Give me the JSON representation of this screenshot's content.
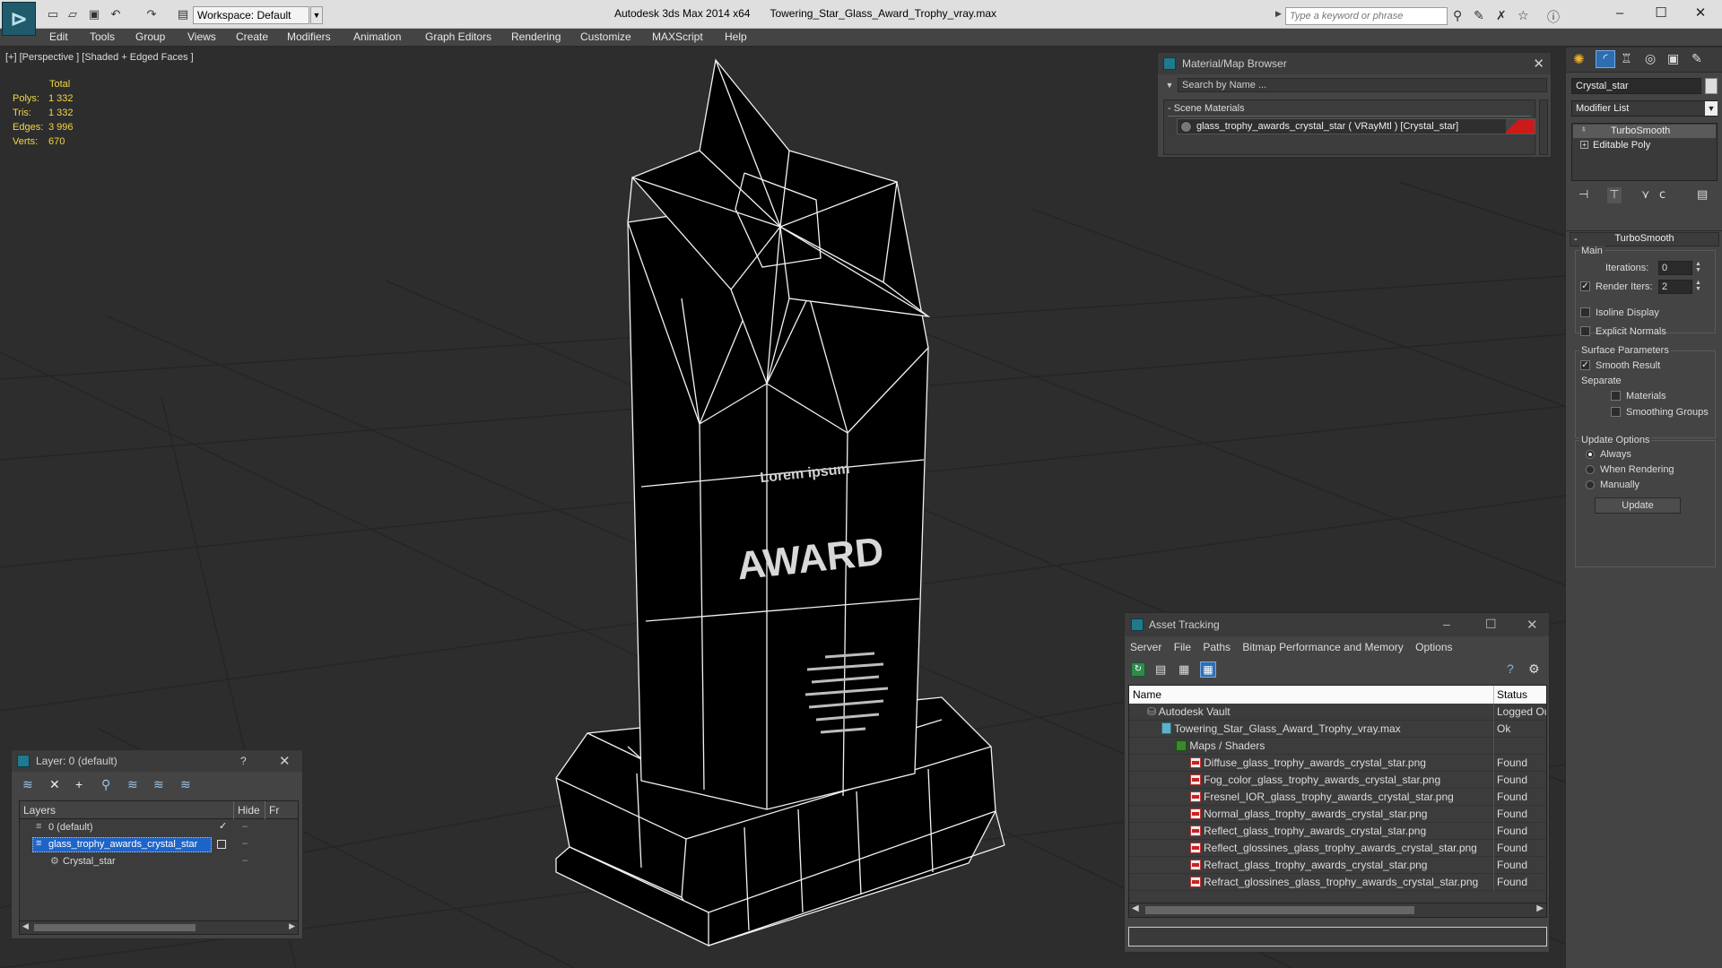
{
  "app": {
    "title": "Autodesk 3ds Max  2014 x64",
    "file": "Towering_Star_Glass_Award_Trophy_vray.max",
    "workspace": "Workspace: Default",
    "search_placeholder": "Type a keyword or phrase"
  },
  "menu": [
    "Edit",
    "Tools",
    "Group",
    "Views",
    "Create",
    "Modifiers",
    "Animation",
    "Graph Editors",
    "Rendering",
    "Customize",
    "MAXScript",
    "Help"
  ],
  "viewport": {
    "label": "[+] [Perspective ] [Shaded + Edged Faces ]",
    "stats": {
      "header": "Total",
      "rows": [
        {
          "label": "Polys:",
          "value": "1 332"
        },
        {
          "label": "Tris:",
          "value": "1 332"
        },
        {
          "label": "Edges:",
          "value": "3 996"
        },
        {
          "label": "Verts:",
          "value": "670"
        }
      ]
    },
    "trophy_text": {
      "small": "Lorem ipsum",
      "big": "AWARD"
    }
  },
  "material_browser": {
    "title": "Material/Map Browser",
    "search_placeholder": "Search by Name ...",
    "section": "- Scene Materials",
    "item": "glass_trophy_awards_crystal_star ( VRayMtl ) [Crystal_star]"
  },
  "asset_tracking": {
    "title": "Asset Tracking",
    "menu": [
      "Server",
      "File",
      "Paths",
      "Bitmap Performance and Memory",
      "Options"
    ],
    "columns": {
      "name": "Name",
      "status": "Status"
    },
    "rows": [
      {
        "name": "Autodesk Vault",
        "status": "Logged Ou",
        "level": 0
      },
      {
        "name": "Towering_Star_Glass_Award_Trophy_vray.max",
        "status": "Ok",
        "level": 1
      },
      {
        "name": "Maps / Shaders",
        "status": "",
        "level": 2
      },
      {
        "name": "Diffuse_glass_trophy_awards_crystal_star.png",
        "status": "Found",
        "level": 3
      },
      {
        "name": "Fog_color_glass_trophy_awards_crystal_star.png",
        "status": "Found",
        "level": 3
      },
      {
        "name": "Fresnel_IOR_glass_trophy_awards_crystal_star.png",
        "status": "Found",
        "level": 3
      },
      {
        "name": "Normal_glass_trophy_awards_crystal_star.png",
        "status": "Found",
        "level": 3
      },
      {
        "name": "Reflect_glass_trophy_awards_crystal_star.png",
        "status": "Found",
        "level": 3
      },
      {
        "name": "Reflect_glossines_glass_trophy_awards_crystal_star.png",
        "status": "Found",
        "level": 3
      },
      {
        "name": "Refract_glass_trophy_awards_crystal_star.png",
        "status": "Found",
        "level": 3
      },
      {
        "name": "Refract_glossines_glass_trophy_awards_crystal_star.png",
        "status": "Found",
        "level": 3
      }
    ]
  },
  "layer_panel": {
    "title": "Layer: 0 (default)",
    "help": "?",
    "columns": {
      "layers": "Layers",
      "hide": "Hide",
      "freeze": "Fr"
    },
    "rows": [
      {
        "name": "0 (default)",
        "selected": false
      },
      {
        "name": "glass_trophy_awards_crystal_star",
        "selected": true
      },
      {
        "name": "Crystal_star",
        "selected": false
      }
    ]
  },
  "command_panel": {
    "object_name": "Crystal_star",
    "modifier_list": "Modifier List",
    "stack": [
      "TurboSmooth",
      "Editable Poly"
    ],
    "rollout_title": "TurboSmooth",
    "main_group": "Main",
    "iterations_label": "Iterations:",
    "iterations_value": "0",
    "render_iters_label": "Render Iters:",
    "render_iters_value": "2",
    "isoline_display": "Isoline Display",
    "explicit_normals": "Explicit Normals",
    "surface_group": "Surface Parameters",
    "smooth_result": "Smooth Result",
    "separate_label": "Separate",
    "materials": "Materials",
    "smoothing_groups": "Smoothing Groups",
    "update_group": "Update Options",
    "always": "Always",
    "when_rendering": "When Rendering",
    "manually": "Manually",
    "update_button": "Update"
  },
  "colors": {
    "selection": "#1e64c8",
    "accent_red": "#cc1a1a",
    "stats": "#f1d64a",
    "panel": "#444444",
    "viewport": "#2d2d2d"
  }
}
